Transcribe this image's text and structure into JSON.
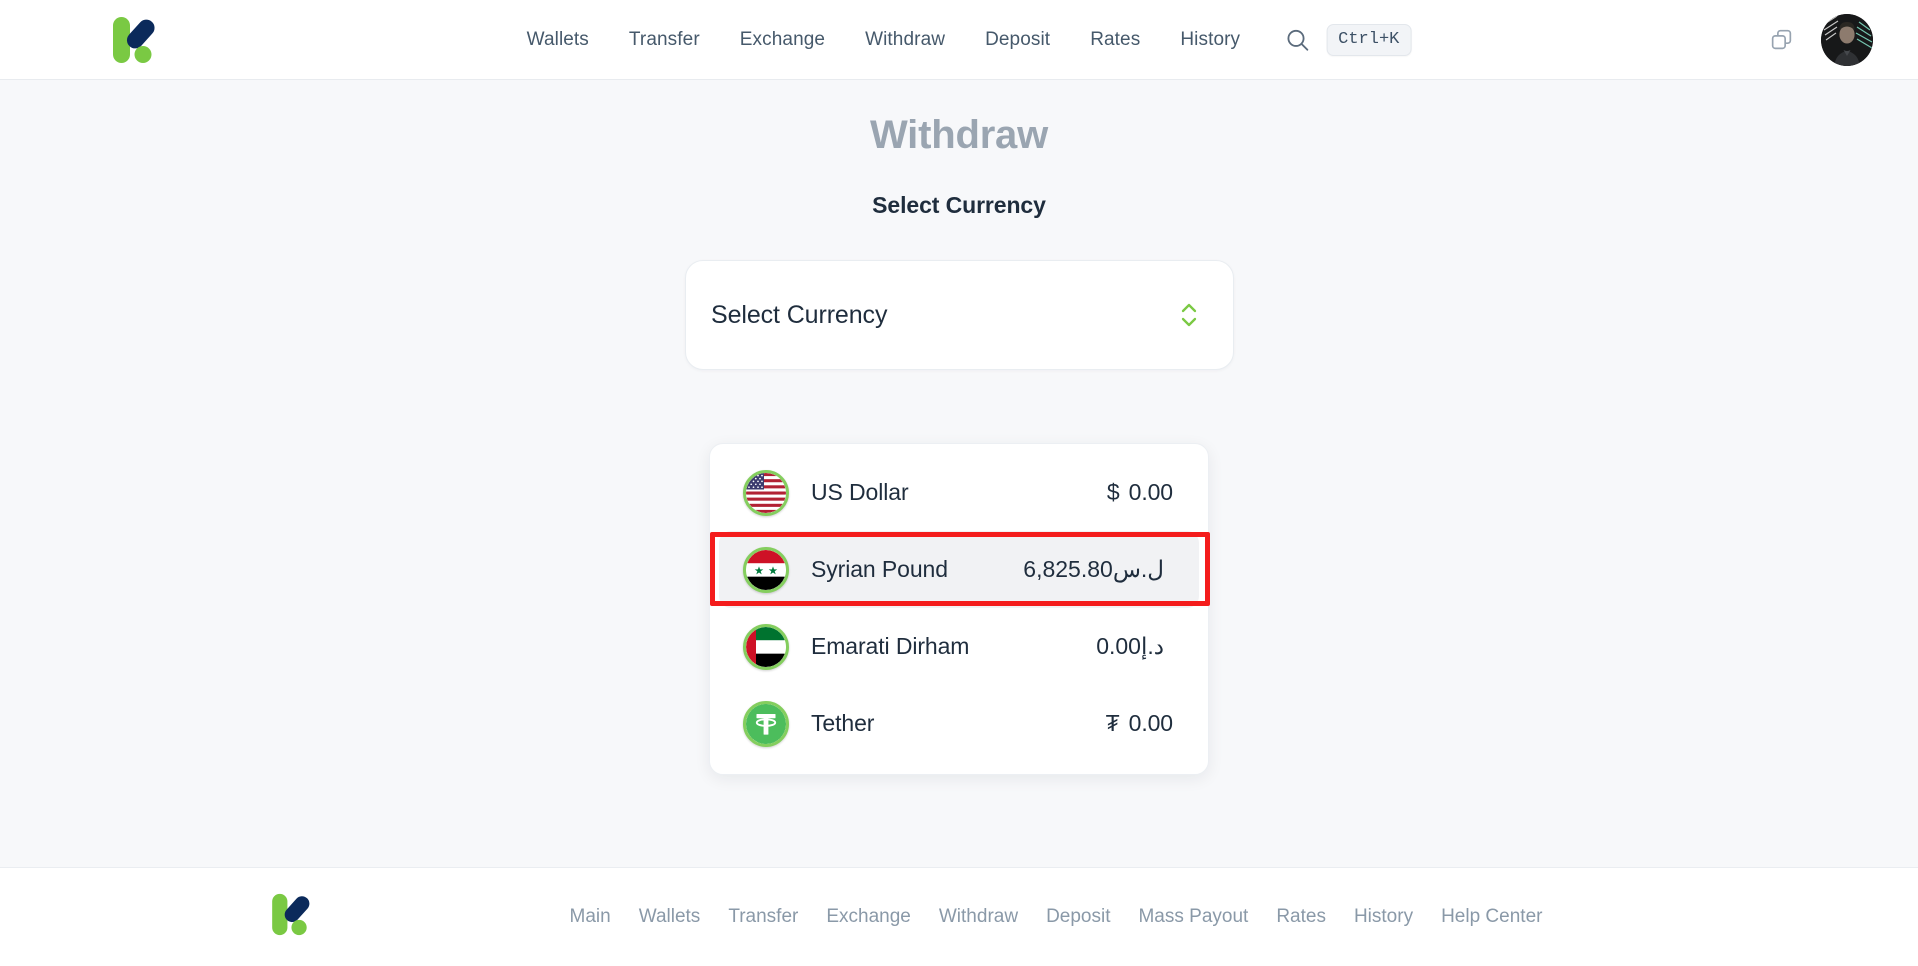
{
  "header": {
    "logo_name": "kasheer-logo",
    "nav": [
      {
        "label": "Wallets"
      },
      {
        "label": "Transfer"
      },
      {
        "label": "Exchange"
      },
      {
        "label": "Withdraw"
      },
      {
        "label": "Deposit"
      },
      {
        "label": "Rates"
      },
      {
        "label": "History"
      }
    ],
    "search_icon": "search-icon",
    "shortcut_badge": "Ctrl+K",
    "copy_icon": "copy-icon",
    "avatar_name": "user-avatar"
  },
  "main": {
    "page_title": "Withdraw",
    "section_label": "Select Currency",
    "select": {
      "value": "Select Currency",
      "placeholder": "Select Currency",
      "chevron_icon": "chevron-up-down-icon",
      "chevron_color": "#7ac943"
    },
    "dropdown": {
      "options": [
        {
          "name": "US Dollar",
          "symbol": "$",
          "amount": "0.00",
          "flag": "us-flag-icon",
          "selected": false
        },
        {
          "name": "Syrian Pound",
          "symbol": "ل.س",
          "amount": "6,825.80",
          "flag": "syria-flag-icon",
          "selected": true
        },
        {
          "name": "Emarati Dirham",
          "symbol": "د.إ",
          "amount": "0.00",
          "flag": "uae-flag-icon",
          "selected": false
        },
        {
          "name": "Tether",
          "symbol": "₮",
          "amount": "0.00",
          "flag": "tether-icon",
          "selected": false
        }
      ]
    },
    "annotation": {
      "target": "Syrian Pound",
      "color": "#f41c1c"
    }
  },
  "footer": {
    "logo_name": "kasheer-logo-footer",
    "links": [
      {
        "label": "Main"
      },
      {
        "label": "Wallets"
      },
      {
        "label": "Transfer"
      },
      {
        "label": "Exchange"
      },
      {
        "label": "Withdraw"
      },
      {
        "label": "Deposit"
      },
      {
        "label": "Mass Payout"
      },
      {
        "label": "Rates"
      },
      {
        "label": "History"
      },
      {
        "label": "Help Center"
      }
    ]
  },
  "colors": {
    "brand_green": "#7ac943",
    "brand_navy": "#0b2a5b",
    "page_bg": "#f7f8fa",
    "accent_red": "#f41c1c"
  }
}
